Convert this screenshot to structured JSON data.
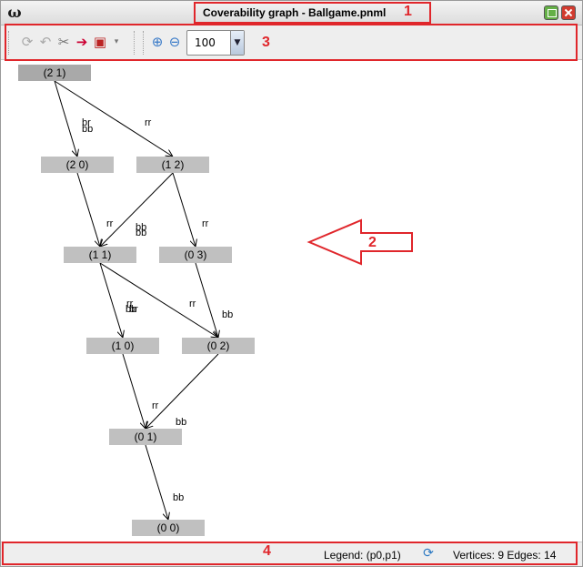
{
  "window": {
    "app_icon": "ω",
    "title": "Coverability graph - Ballgame.pnml",
    "maximize_icon": "maximize-icon",
    "close_icon": "close-icon"
  },
  "toolbar": {
    "icons": [
      "refresh-icon",
      "undo-icon",
      "settings-tools-icon",
      "export-icon",
      "layout-menu-icon",
      "zoom-in-icon",
      "zoom-out-icon"
    ],
    "zoom_value": "100"
  },
  "graph": {
    "nodes": [
      {
        "id": "n21",
        "label": "(2 1)",
        "root": true
      },
      {
        "id": "n20",
        "label": "(2 0)"
      },
      {
        "id": "n12",
        "label": "(1 2)"
      },
      {
        "id": "n11",
        "label": "(1 1)"
      },
      {
        "id": "n03",
        "label": "(0 3)"
      },
      {
        "id": "n10",
        "label": "(1 0)"
      },
      {
        "id": "n02",
        "label": "(0 2)"
      },
      {
        "id": "n01",
        "label": "(0 1)"
      },
      {
        "id": "n00",
        "label": "(0 0)"
      }
    ],
    "edges": [
      {
        "from": "n21",
        "to": "n20",
        "label": "bb"
      },
      {
        "from": "n21",
        "to": "n12",
        "label": "rr"
      },
      {
        "from": "n20",
        "to": "n11",
        "label": "rr"
      },
      {
        "from": "n12",
        "to": "n11",
        "label": "bb"
      },
      {
        "from": "n12",
        "to": "n03",
        "label": "rr"
      },
      {
        "from": "n11",
        "to": "n10",
        "label": "bb"
      },
      {
        "from": "n11",
        "to": "n02",
        "label": "rr"
      },
      {
        "from": "n03",
        "to": "n02",
        "label": "bb"
      },
      {
        "from": "n10",
        "to": "n01",
        "label": "rr"
      },
      {
        "from": "n02",
        "to": "n01",
        "label": "bb"
      },
      {
        "from": "n01",
        "to": "n00",
        "label": "bb"
      }
    ],
    "extra_labels": [
      "br",
      "bb",
      "rr",
      "br"
    ]
  },
  "statusbar": {
    "legend": "Legend: (p0,p1)",
    "refresh_icon": "refresh-icon",
    "counts": "Vertices: 9 Edges: 14"
  },
  "annotations": {
    "numbers": [
      "1",
      "2",
      "3",
      "4"
    ],
    "color": "#e0262b"
  }
}
